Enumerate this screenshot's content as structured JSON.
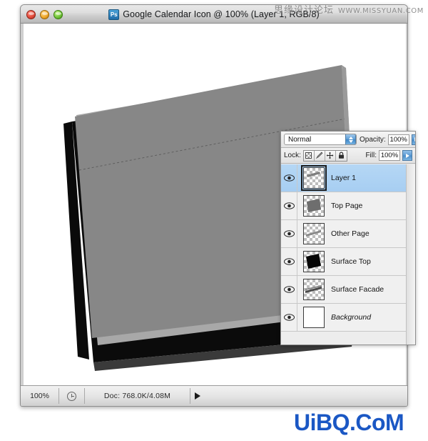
{
  "window": {
    "title": "Google Calendar Icon @ 100% (Layer 1, RGB/8)",
    "app_icon": "photoshop-ps-icon",
    "traffic_lights": [
      {
        "name": "close",
        "color": "#e24b3b"
      },
      {
        "name": "minimize",
        "color": "#f0a92c"
      },
      {
        "name": "zoom",
        "color": "#72c63a"
      }
    ]
  },
  "statusbar": {
    "zoom": "100%",
    "clock_icon": "clock-icon",
    "doc_info": "Doc: 768.0K/4.08M",
    "arrow_icon": "triangle-right-icon"
  },
  "layers_panel": {
    "blend_mode": "Normal",
    "opacity_label": "Opacity:",
    "opacity_value": "100%",
    "lock_label": "Lock:",
    "fill_label": "Fill:",
    "fill_value": "100%",
    "lock_buttons": [
      {
        "name": "lock-transparent-pixels-icon",
        "glyph": "checker"
      },
      {
        "name": "lock-image-pixels-brush-icon",
        "glyph": "brush"
      },
      {
        "name": "lock-position-move-icon",
        "glyph": "move"
      },
      {
        "name": "lock-all-padlock-icon",
        "glyph": "padlock"
      }
    ],
    "layers": [
      {
        "name": "Layer 1",
        "selected": true,
        "italic": false,
        "locked": false,
        "thumb": "streak"
      },
      {
        "name": "Top Page",
        "selected": false,
        "italic": false,
        "locked": false,
        "thumb": "gray-rect"
      },
      {
        "name": "Other Page",
        "selected": false,
        "italic": false,
        "locked": false,
        "thumb": "thin-streak"
      },
      {
        "name": "Surface Top",
        "selected": false,
        "italic": false,
        "locked": false,
        "thumb": "black-rect"
      },
      {
        "name": "Surface Facade",
        "selected": false,
        "italic": false,
        "locked": false,
        "thumb": "facade-streak"
      },
      {
        "name": "Background",
        "selected": false,
        "italic": true,
        "locked": true,
        "thumb": "white"
      }
    ]
  },
  "watermarks": {
    "top_cn": "思缘设计论坛",
    "top_url": "WWW.MISSYUAN.COM",
    "bottom": "UiBQ.CoM",
    "bottom_color": "#1a57c4"
  },
  "colors": {
    "selection_blue": "#a7cef2",
    "panel_bg": "#ebebeb",
    "titlebar": "#dedede",
    "artwork_gray": "#878787",
    "artwork_black": "#0b0b0b"
  }
}
